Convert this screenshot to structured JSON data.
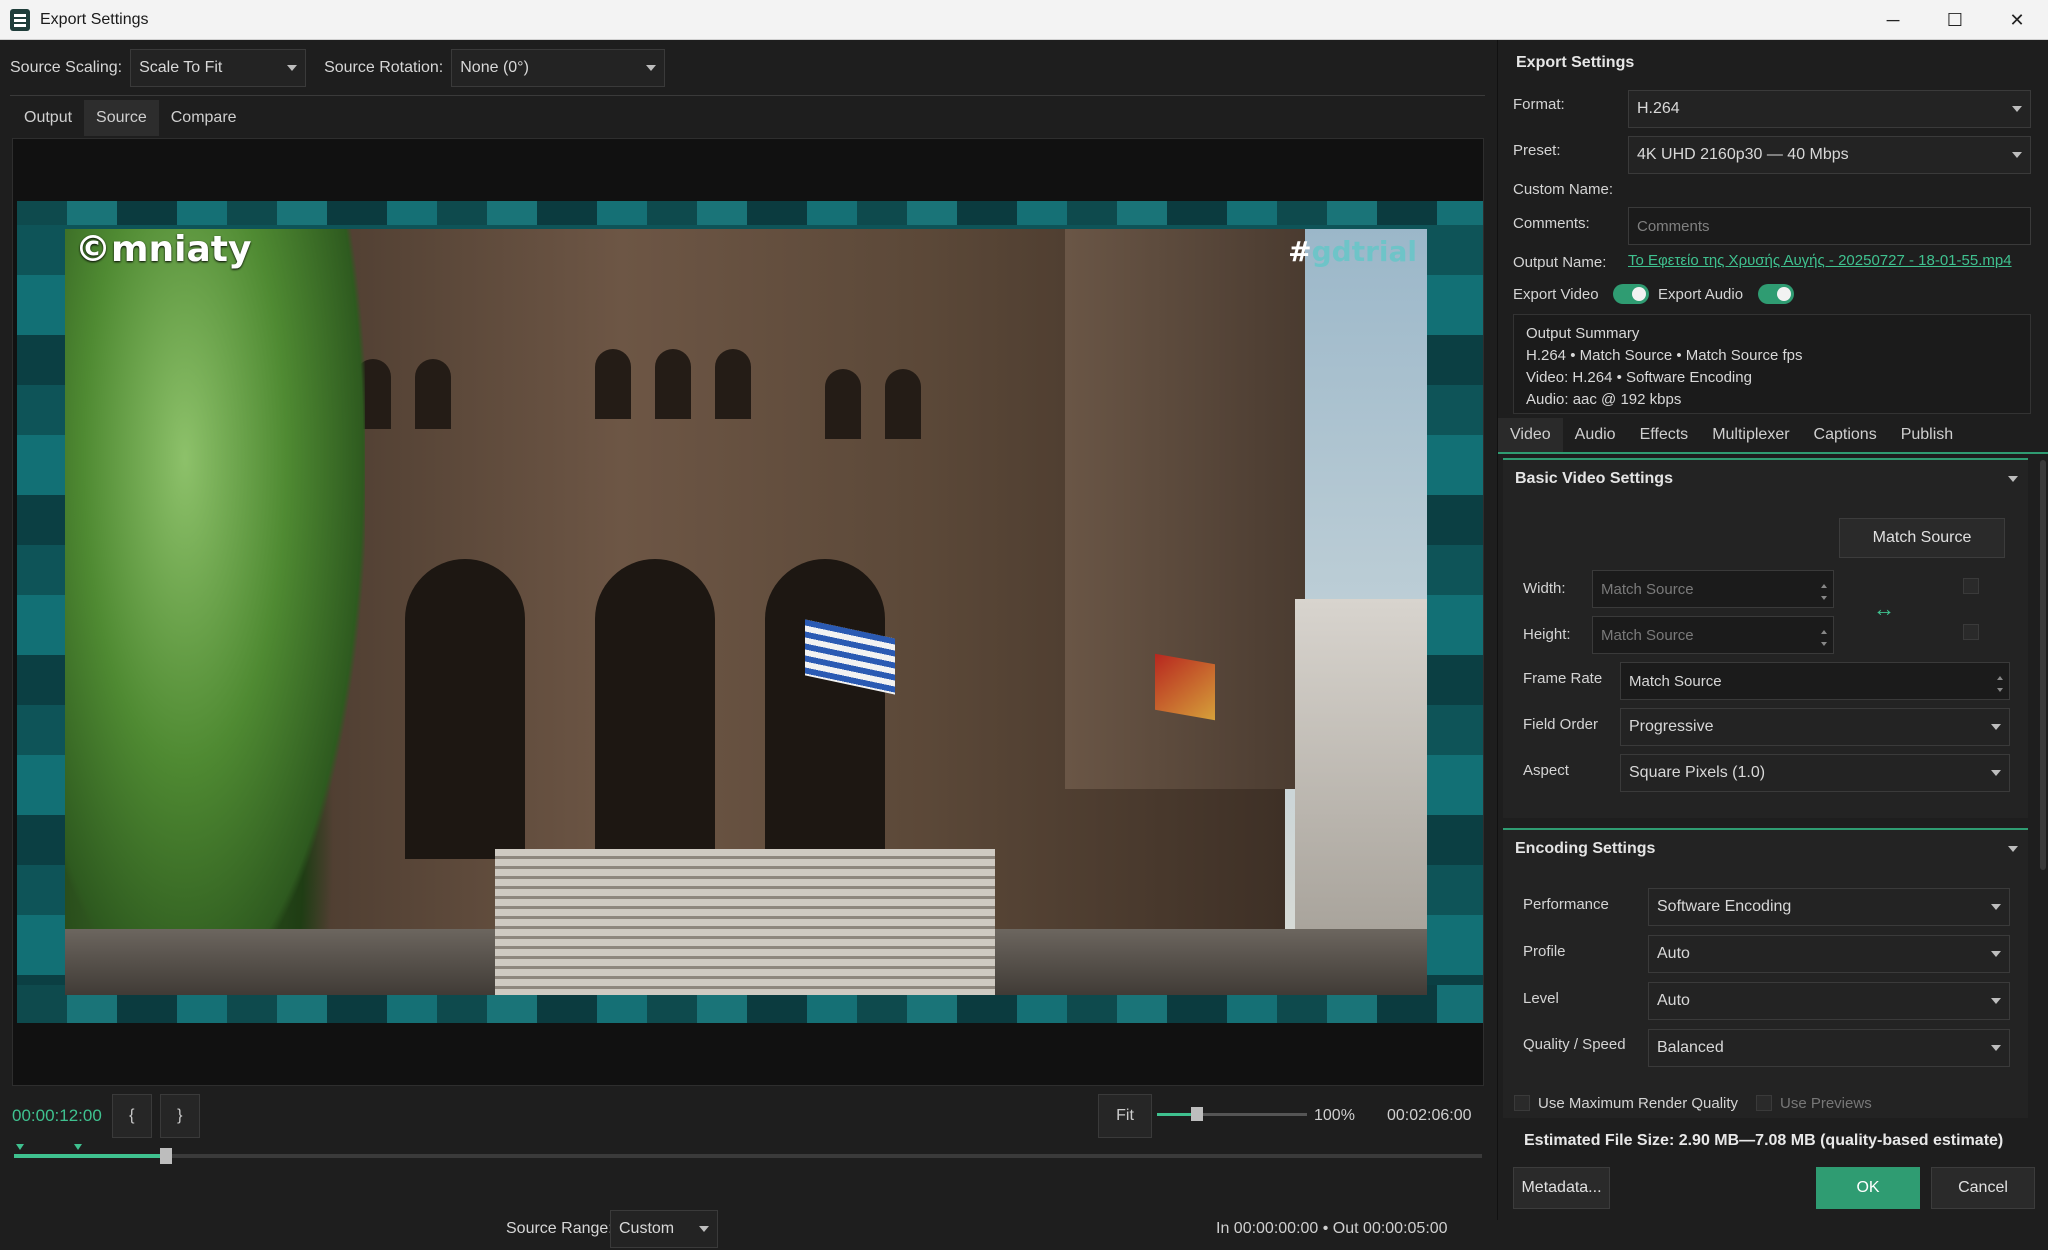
{
  "window": {
    "title": "Export Settings",
    "controls": [
      "─",
      "☐",
      "✕"
    ]
  },
  "source_bar": {
    "scaling_label": "Source Scaling:",
    "scaling_value": "Scale To Fit",
    "rotation_label": "Source Rotation:",
    "rotation_value": "None (0°)"
  },
  "view_tabs": [
    {
      "label": "Output",
      "active": false
    },
    {
      "label": "Source",
      "active": true
    },
    {
      "label": "Compare",
      "active": false
    }
  ],
  "video_overlay": {
    "logo": "©mniaty",
    "hashtag_prefix": "#",
    "hashtag": "gdtrial"
  },
  "transport": {
    "timecode": "00:00:12:00",
    "mark_in": "{",
    "mark_out": "}",
    "fit": "Fit",
    "zoom": "100%",
    "duration": "00:02:06:00",
    "playhead_fraction": 0.1
  },
  "range": {
    "label": "Source Range:",
    "value": "Custom",
    "in_out": "In 00:00:00:00  •  Out 00:00:05:00"
  },
  "export": {
    "title": "Export Settings",
    "format_label": "Format:",
    "format_value": "H.264",
    "preset_label": "Preset:",
    "preset_value": "4K UHD 2160p30 — 40 Mbps",
    "custom_name_label": "Custom Name:",
    "comments_label": "Comments:",
    "comments_placeholder": "Comments",
    "output_name_label": "Output Name:",
    "output_name_value": "Το Εφετείο της Χρυσής Αυγής - 20250727 - 18-01-55.mp4",
    "export_video_label": "Export Video",
    "export_audio_label": "Export Audio",
    "export_video_on": true,
    "export_audio_on": true
  },
  "summary": {
    "title": "Output Summary",
    "line1": "H.264 • Match Source • Match Source fps",
    "line2": "Video: H.264 • Software Encoding",
    "line3": "Audio: aac @ 192 kbps"
  },
  "settings_tabs": [
    {
      "label": "Video",
      "active": true
    },
    {
      "label": "Audio",
      "active": false
    },
    {
      "label": "Effects",
      "active": false
    },
    {
      "label": "Multiplexer",
      "active": false
    },
    {
      "label": "Captions",
      "active": false
    },
    {
      "label": "Publish",
      "active": false
    }
  ],
  "basic_video": {
    "title": "Basic Video Settings",
    "match_source_button": "Match Source",
    "width_label": "Width:",
    "width_placeholder": "Match Source",
    "height_label": "Height:",
    "height_placeholder": "Match Source",
    "frame_rate_label": "Frame Rate",
    "frame_rate_value": "Match Source",
    "field_order_label": "Field Order",
    "field_order_value": "Progressive",
    "aspect_label": "Aspect",
    "aspect_value": "Square Pixels (1.0)",
    "link_icon": "↔"
  },
  "encoding": {
    "title": "Encoding Settings",
    "performance_label": "Performance",
    "performance_value": "Software Encoding",
    "profile_label": "Profile",
    "profile_value": "Auto",
    "level_label": "Level",
    "level_value": "Auto",
    "quality_label": "Quality / Speed",
    "quality_value": "Balanced"
  },
  "footer": {
    "max_render_label": "Use Maximum Render Quality",
    "use_previews_label": "Use Previews",
    "estimate": "Estimated File Size: 2.90 MB—7.08 MB (quality-based estimate)",
    "metadata_button": "Metadata...",
    "ok_button": "OK",
    "cancel_button": "Cancel"
  },
  "colors": {
    "accent": "#2f9c72",
    "timecode": "#3fc18f",
    "background": "#1e1e1e"
  }
}
